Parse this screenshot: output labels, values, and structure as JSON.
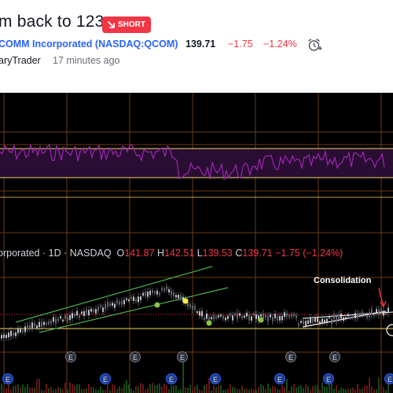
{
  "idea": {
    "title": "m back to 123",
    "badge": "SHORT"
  },
  "symbol": {
    "name_and_ticker": "COMM Incorporated (NASDAQ:QCOM)",
    "last": "139.71",
    "change": "−1.75",
    "change_pct": "−1.24%",
    "alarm_icon": "alarm-clock-plus-icon"
  },
  "author": {
    "name": "aryTrader",
    "time": "17 minutes ago"
  },
  "chart": {
    "legend": {
      "name": "orporated",
      "interval": "1D",
      "exchange": "NASDAQ",
      "open_label": "O",
      "open": "141.87",
      "high_label": "H",
      "high": "142.51",
      "low_label": "L",
      "low": "139.53",
      "close_label": "C",
      "close": "139.71",
      "change": "−1.75",
      "change_pct": "(−1.24%)"
    },
    "annotation": "Consolidation",
    "earnings_marker": "E",
    "colors": {
      "background": "#000000",
      "grid": "#6e3a14",
      "oscillator": "#9c27b0",
      "oscillator_band": "#2a0d33",
      "level_line": "#f5d76e",
      "channel": "#4caf50",
      "candle": "#d1d4dc",
      "markers_green": "#8bc34a",
      "marker_yellow": "#ffeb3b",
      "support": "#f23645",
      "trendline": "#ffffff"
    }
  }
}
